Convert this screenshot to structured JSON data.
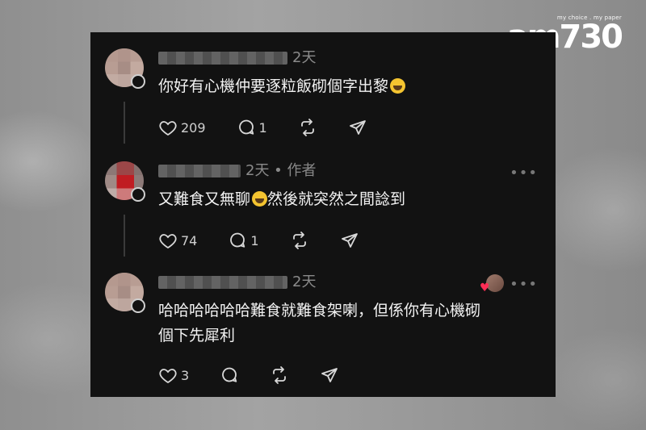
{
  "logo": {
    "tagline": "my choice . my paper",
    "brand": "am730"
  },
  "comments": [
    {
      "time": "2天",
      "text": "你好有心機仲要逐粒飯砌個字出黎",
      "likes": "209",
      "replies": "1"
    },
    {
      "time": "2天",
      "author_tag": "作者",
      "text_part1": "又難食又無聊",
      "text_part2": "然後就突然之間諗到",
      "likes": "74",
      "replies": "1"
    },
    {
      "time": "2天",
      "text_line1": "哈哈哈哈哈哈難食就難食架喇，但係你有心機砌",
      "text_line2": "個下先犀利",
      "likes": "3"
    }
  ],
  "icons": {
    "like": "heart-icon",
    "reply": "comment-icon",
    "repost": "repost-icon",
    "share": "send-icon",
    "more": "more-icon",
    "emoji": "laughing-emoji"
  }
}
